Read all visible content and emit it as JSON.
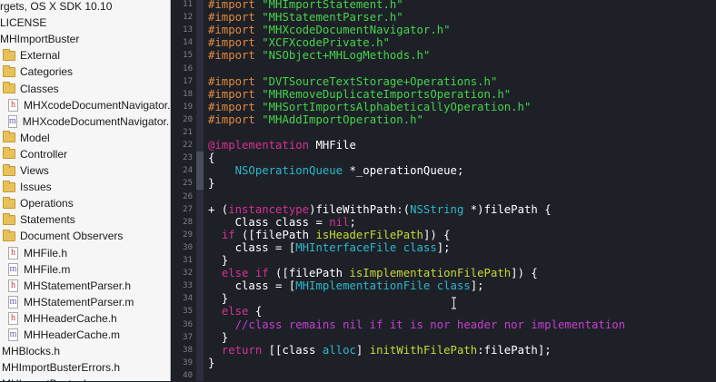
{
  "navigator": {
    "rows": [
      {
        "kind": "none",
        "label": "rgets, OS X SDK 10.10"
      },
      {
        "kind": "none",
        "label": "LICENSE"
      },
      {
        "kind": "none",
        "label": "MHImportBuster"
      },
      {
        "kind": "folder",
        "label": "External"
      },
      {
        "kind": "folder",
        "label": "Categories"
      },
      {
        "kind": "folder",
        "label": "Classes"
      },
      {
        "kind": "h",
        "label": "MHXcodeDocumentNavigator.h"
      },
      {
        "kind": "m",
        "label": "MHXcodeDocumentNavigator.m"
      },
      {
        "kind": "folder",
        "label": "Model"
      },
      {
        "kind": "folder",
        "label": "Controller"
      },
      {
        "kind": "folder",
        "label": "Views"
      },
      {
        "kind": "folder",
        "label": "Issues"
      },
      {
        "kind": "folder",
        "label": "Operations"
      },
      {
        "kind": "folder",
        "label": "Statements"
      },
      {
        "kind": "folder",
        "label": "Document Observers"
      },
      {
        "kind": "h",
        "label": "MHFile.h"
      },
      {
        "kind": "m",
        "label": "MHFile.m"
      },
      {
        "kind": "h",
        "label": "MHStatementParser.h"
      },
      {
        "kind": "m",
        "label": "MHStatementParser.m"
      },
      {
        "kind": "h",
        "label": "MHHeaderCache.h"
      },
      {
        "kind": "m",
        "label": "MHHeaderCache.m"
      },
      {
        "kind": "none",
        "label": "MHBlocks.h"
      },
      {
        "kind": "none",
        "label": "MHImportBusterErrors.h"
      },
      {
        "kind": "none",
        "label": "MHImportBuster.h"
      }
    ]
  },
  "editor": {
    "lines": [
      {
        "num": "11",
        "tokens": [
          [
            "pp",
            "#import "
          ],
          [
            "str",
            "\"MHImportStatement.h\""
          ]
        ]
      },
      {
        "num": "12",
        "tokens": [
          [
            "pp",
            "#import "
          ],
          [
            "str",
            "\"MHStatementParser.h\""
          ]
        ]
      },
      {
        "num": "13",
        "tokens": [
          [
            "pp",
            "#import "
          ],
          [
            "str",
            "\"MHXcodeDocumentNavigator.h\""
          ]
        ]
      },
      {
        "num": "14",
        "tokens": [
          [
            "pp",
            "#import "
          ],
          [
            "str",
            "\"XCFXcodePrivate.h\""
          ]
        ]
      },
      {
        "num": "15",
        "tokens": [
          [
            "pp",
            "#import "
          ],
          [
            "str",
            "\"NSObject+MHLogMethods.h\""
          ]
        ]
      },
      {
        "num": "16",
        "tokens": []
      },
      {
        "num": "17",
        "tokens": [
          [
            "pp",
            "#import "
          ],
          [
            "str",
            "\"DVTSourceTextStorage+Operations.h\""
          ]
        ]
      },
      {
        "num": "18",
        "tokens": [
          [
            "pp",
            "#import "
          ],
          [
            "str",
            "\"MHRemoveDuplicateImportsOperation.h\""
          ]
        ]
      },
      {
        "num": "19",
        "tokens": [
          [
            "pp",
            "#import "
          ],
          [
            "str",
            "\"MHSortImportsAlphabeticallyOperation.h\""
          ]
        ]
      },
      {
        "num": "20",
        "tokens": [
          [
            "pp",
            "#import "
          ],
          [
            "str",
            "\"MHAddImportOperation.h\""
          ]
        ]
      },
      {
        "num": "21",
        "tokens": []
      },
      {
        "num": "22",
        "tokens": [
          [
            "kw",
            "@implementation"
          ],
          [
            "plain",
            " MHFile"
          ]
        ]
      },
      {
        "num": "23",
        "tokens": [
          [
            "plain",
            "{"
          ]
        ]
      },
      {
        "num": "24",
        "tokens": [
          [
            "plain",
            "    "
          ],
          [
            "type",
            "NSOperationQueue"
          ],
          [
            "plain",
            " *_operationQueue;"
          ]
        ]
      },
      {
        "num": "25",
        "tokens": [
          [
            "plain",
            "}"
          ]
        ]
      },
      {
        "num": "26",
        "tokens": []
      },
      {
        "num": "27",
        "tokens": [
          [
            "plain",
            "+ ("
          ],
          [
            "kw",
            "instancetype"
          ],
          [
            "plain",
            ")fileWithPath:("
          ],
          [
            "type",
            "NSString"
          ],
          [
            "plain",
            " *)filePath {"
          ]
        ]
      },
      {
        "num": "28",
        "tokens": [
          [
            "plain",
            "    Class class = "
          ],
          [
            "kw",
            "nil"
          ],
          [
            "plain",
            ";"
          ]
        ]
      },
      {
        "num": "29",
        "tokens": [
          [
            "plain",
            "  "
          ],
          [
            "kw",
            "if"
          ],
          [
            "plain",
            " ([filePath "
          ],
          [
            "meth",
            "isHeaderFilePath"
          ],
          [
            "plain",
            "]) {"
          ]
        ]
      },
      {
        "num": "30",
        "tokens": [
          [
            "plain",
            "    class = ["
          ],
          [
            "type",
            "MHInterfaceFile"
          ],
          [
            "plain",
            " "
          ],
          [
            "type",
            "class"
          ],
          [
            "plain",
            "];"
          ]
        ]
      },
      {
        "num": "31",
        "tokens": [
          [
            "plain",
            "  }"
          ]
        ]
      },
      {
        "num": "32",
        "tokens": [
          [
            "plain",
            "  "
          ],
          [
            "kw",
            "else if"
          ],
          [
            "plain",
            " ([filePath "
          ],
          [
            "meth",
            "isImplementationFilePath"
          ],
          [
            "plain",
            "]) {"
          ]
        ]
      },
      {
        "num": "33",
        "tokens": [
          [
            "plain",
            "    class = ["
          ],
          [
            "type",
            "MHImplementationFile"
          ],
          [
            "plain",
            " "
          ],
          [
            "type",
            "class"
          ],
          [
            "plain",
            "];"
          ]
        ]
      },
      {
        "num": "34",
        "tokens": [
          [
            "plain",
            "  }"
          ]
        ]
      },
      {
        "num": "35",
        "tokens": [
          [
            "plain",
            "  "
          ],
          [
            "kw",
            "else"
          ],
          [
            "plain",
            " {"
          ]
        ]
      },
      {
        "num": "36",
        "tokens": [
          [
            "com",
            "    //class remains nil if it is nor header nor implementation"
          ]
        ]
      },
      {
        "num": "37",
        "tokens": [
          [
            "plain",
            "  }"
          ]
        ]
      },
      {
        "num": "38",
        "tokens": [
          [
            "plain",
            "  "
          ],
          [
            "kw",
            "return"
          ],
          [
            "plain",
            " [[class "
          ],
          [
            "type",
            "alloc"
          ],
          [
            "plain",
            "] "
          ],
          [
            "meth",
            "initWithFilePath"
          ],
          [
            "plain",
            ":filePath];"
          ]
        ]
      },
      {
        "num": "39",
        "tokens": [
          [
            "plain",
            "}"
          ]
        ]
      },
      {
        "num": "40",
        "tokens": []
      }
    ]
  },
  "colors": {
    "editor_bg": "#1e2028",
    "keyword": "#d6318f",
    "preprocessor": "#e08a3c",
    "string": "#44d44a",
    "type": "#2bb8c9",
    "method": "#c6d934",
    "comment": "#c73fce"
  },
  "icons": {
    "folder": "folder-icon",
    "header_file": "header-file-icon",
    "implementation_file": "implementation-file-icon",
    "cursor": "ibeam-cursor-icon"
  }
}
